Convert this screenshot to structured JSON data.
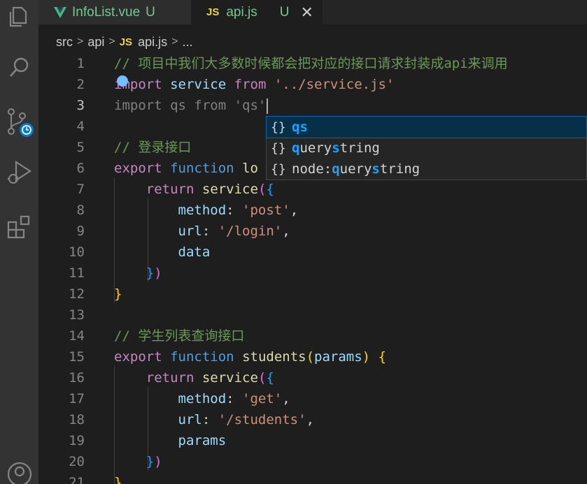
{
  "tabs": [
    {
      "name": "InfoList.vue",
      "status": "U"
    },
    {
      "badge": "JS",
      "name": "api.js",
      "status": "U"
    }
  ],
  "breadcrumb": {
    "parts": [
      "src",
      "api"
    ],
    "file_badge": "JS",
    "file": "api.js",
    "ellipsis": "..."
  },
  "editor": {
    "lines": [
      {
        "n": "1",
        "tokens": [
          [
            "cm",
            "// 项目中我们大多数时候都会把对应的接口请求封装成api来调用"
          ]
        ]
      },
      {
        "n": "2",
        "tokens": [
          [
            "kw",
            "import"
          ],
          [
            "t",
            " "
          ],
          [
            "var",
            "service"
          ],
          [
            "t",
            " "
          ],
          [
            "kw",
            "from"
          ],
          [
            "t",
            " "
          ],
          [
            "str",
            "'../service.js'"
          ]
        ]
      },
      {
        "n": "3",
        "tokens": [
          [
            "ghost",
            "import qs from 'qs'"
          ]
        ]
      },
      {
        "n": "4",
        "tokens": []
      },
      {
        "n": "5",
        "tokens": [
          [
            "cm",
            "// 登录接口"
          ]
        ]
      },
      {
        "n": "6",
        "tokens": [
          [
            "kw",
            "export"
          ],
          [
            "t",
            " "
          ],
          [
            "sk",
            "function"
          ],
          [
            "t",
            " "
          ],
          [
            "fn",
            "lo"
          ]
        ]
      },
      {
        "n": "7",
        "tokens": [
          [
            "t",
            "    "
          ],
          [
            "kw",
            "return"
          ],
          [
            "t",
            " "
          ],
          [
            "fn",
            "service"
          ],
          [
            "br2",
            "("
          ],
          [
            "br3",
            "{"
          ]
        ]
      },
      {
        "n": "8",
        "tokens": [
          [
            "t",
            "        "
          ],
          [
            "var",
            "method"
          ],
          [
            "t",
            ": "
          ],
          [
            "str",
            "'post'"
          ],
          [
            "t",
            ","
          ]
        ]
      },
      {
        "n": "9",
        "tokens": [
          [
            "t",
            "        "
          ],
          [
            "var",
            "url"
          ],
          [
            "t",
            ": "
          ],
          [
            "str",
            "'/login'"
          ],
          [
            "t",
            ","
          ]
        ]
      },
      {
        "n": "10",
        "tokens": [
          [
            "t",
            "        "
          ],
          [
            "var",
            "data"
          ]
        ]
      },
      {
        "n": "11",
        "tokens": [
          [
            "t",
            "    "
          ],
          [
            "br3",
            "}"
          ],
          [
            "br2",
            ")"
          ]
        ]
      },
      {
        "n": "12",
        "tokens": [
          [
            "br1",
            "}"
          ]
        ]
      },
      {
        "n": "13",
        "tokens": []
      },
      {
        "n": "14",
        "tokens": [
          [
            "cm",
            "// 学生列表查询接口"
          ]
        ]
      },
      {
        "n": "15",
        "tokens": [
          [
            "kw",
            "export"
          ],
          [
            "t",
            " "
          ],
          [
            "sk",
            "function"
          ],
          [
            "t",
            " "
          ],
          [
            "fn",
            "students"
          ],
          [
            "br1",
            "("
          ],
          [
            "var",
            "params"
          ],
          [
            "br1",
            ")"
          ],
          [
            "t",
            " "
          ],
          [
            "br1",
            "{"
          ]
        ]
      },
      {
        "n": "16",
        "tokens": [
          [
            "t",
            "    "
          ],
          [
            "kw",
            "return"
          ],
          [
            "t",
            " "
          ],
          [
            "fn",
            "service"
          ],
          [
            "br2",
            "("
          ],
          [
            "br3",
            "{"
          ]
        ]
      },
      {
        "n": "17",
        "tokens": [
          [
            "t",
            "        "
          ],
          [
            "var",
            "method"
          ],
          [
            "t",
            ": "
          ],
          [
            "str",
            "'get'"
          ],
          [
            "t",
            ","
          ]
        ]
      },
      {
        "n": "18",
        "tokens": [
          [
            "t",
            "        "
          ],
          [
            "var",
            "url"
          ],
          [
            "t",
            ": "
          ],
          [
            "str",
            "'/students'"
          ],
          [
            "t",
            ","
          ]
        ]
      },
      {
        "n": "19",
        "tokens": [
          [
            "t",
            "        "
          ],
          [
            "var",
            "params"
          ]
        ]
      },
      {
        "n": "20",
        "tokens": [
          [
            "t",
            "    "
          ],
          [
            "br3",
            "}"
          ],
          [
            "br2",
            ")"
          ]
        ]
      },
      {
        "n": "21",
        "tokens": [
          [
            "br1",
            "}"
          ]
        ]
      }
    ]
  },
  "suggestions": [
    {
      "icon": "{}",
      "label": [
        "qs"
      ],
      "highlight": [
        true
      ],
      "selected": true
    },
    {
      "icon": "{}",
      "label": [
        "q",
        "uery",
        "s",
        "tring"
      ],
      "highlight": [
        true,
        false,
        true,
        false
      ],
      "selected": false
    },
    {
      "icon": "{}",
      "label": [
        "node:",
        "q",
        "uery",
        "s",
        "tring"
      ],
      "highlight": [
        false,
        true,
        false,
        true,
        false
      ],
      "selected": false
    }
  ],
  "colors": {
    "editor_bg": "#1e1e1e",
    "activity_bar": "#333333",
    "selection": "#062f4a",
    "match": "#18a3ff",
    "untracked": "#73c991"
  },
  "icons": [
    "explorer-icon",
    "search-icon",
    "source-control-icon",
    "run-debug-icon",
    "extensions-icon",
    "account-icon",
    "vue-file-icon",
    "close-icon",
    "lightbulb-icon"
  ]
}
